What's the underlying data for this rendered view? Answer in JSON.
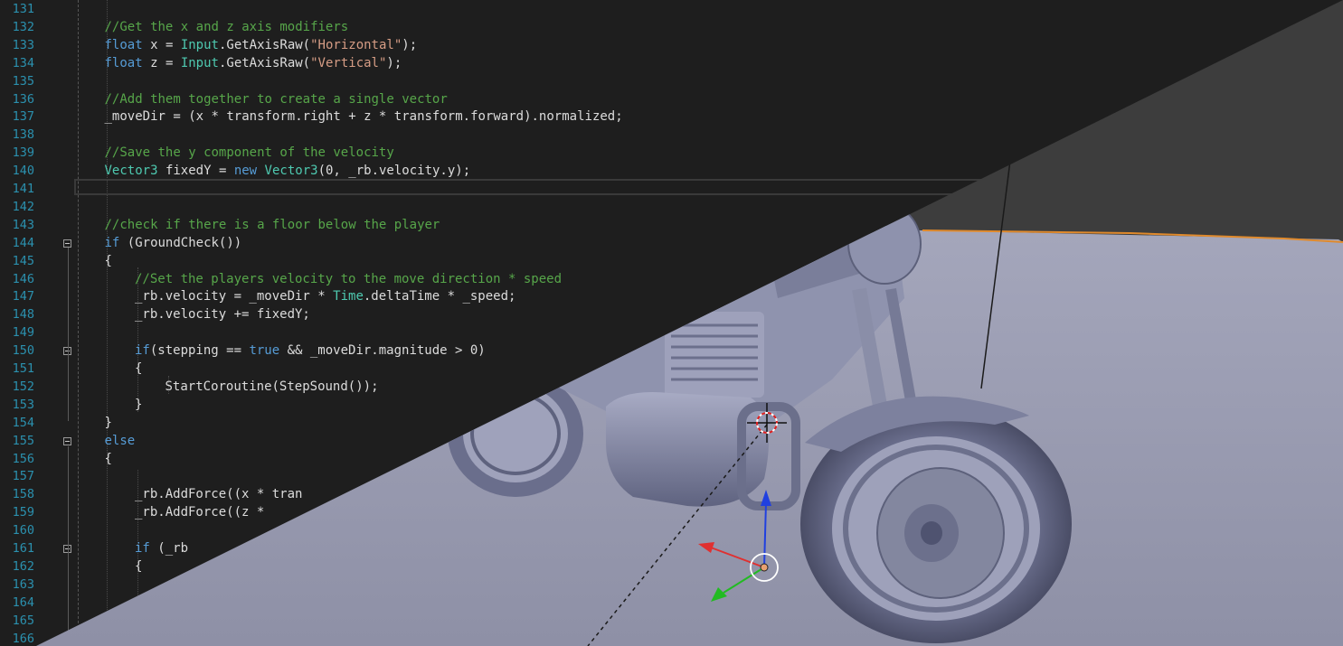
{
  "editor": {
    "lines": [
      {
        "n": "131",
        "indent": 0,
        "parts": []
      },
      {
        "n": "132",
        "indent": 2,
        "parts": [
          [
            "cm",
            "//Get the x and z axis modifiers"
          ]
        ]
      },
      {
        "n": "133",
        "indent": 2,
        "parts": [
          [
            "kw",
            "float"
          ],
          [
            "",
            " x = "
          ],
          [
            "ty",
            "Input"
          ],
          [
            "",
            ".GetAxisRaw("
          ],
          [
            "st",
            "\"Horizontal\""
          ],
          [
            "",
            ");"
          ]
        ]
      },
      {
        "n": "134",
        "indent": 2,
        "parts": [
          [
            "kw",
            "float"
          ],
          [
            "",
            " z = "
          ],
          [
            "ty",
            "Input"
          ],
          [
            "",
            ".GetAxisRaw("
          ],
          [
            "st",
            "\"Vertical\""
          ],
          [
            "",
            ");"
          ]
        ]
      },
      {
        "n": "135",
        "indent": 0,
        "parts": []
      },
      {
        "n": "136",
        "indent": 2,
        "parts": [
          [
            "cm",
            "//Add them together to create a single vector"
          ]
        ]
      },
      {
        "n": "137",
        "indent": 2,
        "parts": [
          [
            "",
            "_moveDir = (x * transform.right + z * transform.forward).normalized;"
          ]
        ]
      },
      {
        "n": "138",
        "indent": 0,
        "parts": []
      },
      {
        "n": "139",
        "indent": 2,
        "parts": [
          [
            "cm",
            "//Save the y component of the velocity"
          ]
        ]
      },
      {
        "n": "140",
        "indent": 2,
        "parts": [
          [
            "ty",
            "Vector3"
          ],
          [
            "",
            " fixedY = "
          ],
          [
            "kw",
            "new"
          ],
          [
            "",
            " "
          ],
          [
            "ty",
            "Vector3"
          ],
          [
            "",
            "(0, _rb.velocity.y);"
          ]
        ]
      },
      {
        "n": "141",
        "indent": 0,
        "parts": []
      },
      {
        "n": "142",
        "indent": 0,
        "parts": []
      },
      {
        "n": "143",
        "indent": 2,
        "parts": [
          [
            "cm",
            "//check if there is a floor below the player"
          ]
        ]
      },
      {
        "n": "144",
        "indent": 2,
        "parts": [
          [
            "kw",
            "if"
          ],
          [
            "",
            " (GroundCheck())"
          ]
        ]
      },
      {
        "n": "145",
        "indent": 2,
        "parts": [
          [
            "",
            "{"
          ]
        ]
      },
      {
        "n": "146",
        "indent": 3,
        "parts": [
          [
            "cm",
            "//Set the players velocity to the move direction * speed"
          ]
        ]
      },
      {
        "n": "147",
        "indent": 3,
        "parts": [
          [
            "",
            "_rb.velocity = _moveDir * "
          ],
          [
            "ty",
            "Time"
          ],
          [
            "",
            ".deltaTime * _speed;"
          ]
        ]
      },
      {
        "n": "148",
        "indent": 3,
        "parts": [
          [
            "",
            "_rb.velocity += fixedY;"
          ]
        ]
      },
      {
        "n": "149",
        "indent": 0,
        "parts": []
      },
      {
        "n": "150",
        "indent": 3,
        "parts": [
          [
            "kw",
            "if"
          ],
          [
            "",
            "(stepping == "
          ],
          [
            "kw",
            "true"
          ],
          [
            "",
            " && _moveDir.magnitude > 0)"
          ]
        ]
      },
      {
        "n": "151",
        "indent": 3,
        "parts": [
          [
            "",
            "{"
          ]
        ]
      },
      {
        "n": "152",
        "indent": 4,
        "parts": [
          [
            "",
            "StartCoroutine(StepSound());"
          ]
        ]
      },
      {
        "n": "153",
        "indent": 3,
        "parts": [
          [
            "",
            "}"
          ]
        ]
      },
      {
        "n": "154",
        "indent": 2,
        "parts": [
          [
            "",
            "}"
          ]
        ]
      },
      {
        "n": "155",
        "indent": 2,
        "parts": [
          [
            "kw",
            "else"
          ]
        ]
      },
      {
        "n": "156",
        "indent": 2,
        "parts": [
          [
            "",
            "{"
          ]
        ]
      },
      {
        "n": "157",
        "indent": 0,
        "parts": []
      },
      {
        "n": "158",
        "indent": 3,
        "parts": [
          [
            "",
            "_rb.AddForce((x * tran"
          ]
        ]
      },
      {
        "n": "159",
        "indent": 3,
        "parts": [
          [
            "",
            "_rb.AddForce((z *"
          ]
        ]
      },
      {
        "n": "160",
        "indent": 0,
        "parts": []
      },
      {
        "n": "161",
        "indent": 3,
        "parts": [
          [
            "kw",
            "if"
          ],
          [
            "",
            " (_rb"
          ]
        ]
      },
      {
        "n": "162",
        "indent": 3,
        "parts": [
          [
            "",
            "{"
          ]
        ]
      },
      {
        "n": "163",
        "indent": 0,
        "parts": []
      },
      {
        "n": "164",
        "indent": 0,
        "parts": []
      },
      {
        "n": "165",
        "indent": 0,
        "parts": []
      },
      {
        "n": "166",
        "indent": 0,
        "parts": []
      }
    ],
    "fold_lines": [
      "144",
      "150",
      "155",
      "161"
    ],
    "current_line": "141"
  },
  "colors": {
    "editor_bg": "#1e1e1e",
    "line_number": "#2b91af",
    "keyword": "#569cd6",
    "type": "#4ec9b0",
    "string": "#d69d85",
    "comment": "#57a64a",
    "viewport_floor": "#9a9cb2",
    "viewport_bg": "#3d3d3d",
    "model": "#7f83a0",
    "horizon_highlight": "#e08a2c",
    "axis_x": "#e03030",
    "axis_y": "#22bb22",
    "axis_z": "#2040e0"
  },
  "viewport": {
    "object": "motorcycle-model",
    "gizmo": "transform-gizmo",
    "cursor": "3d-cursor"
  }
}
